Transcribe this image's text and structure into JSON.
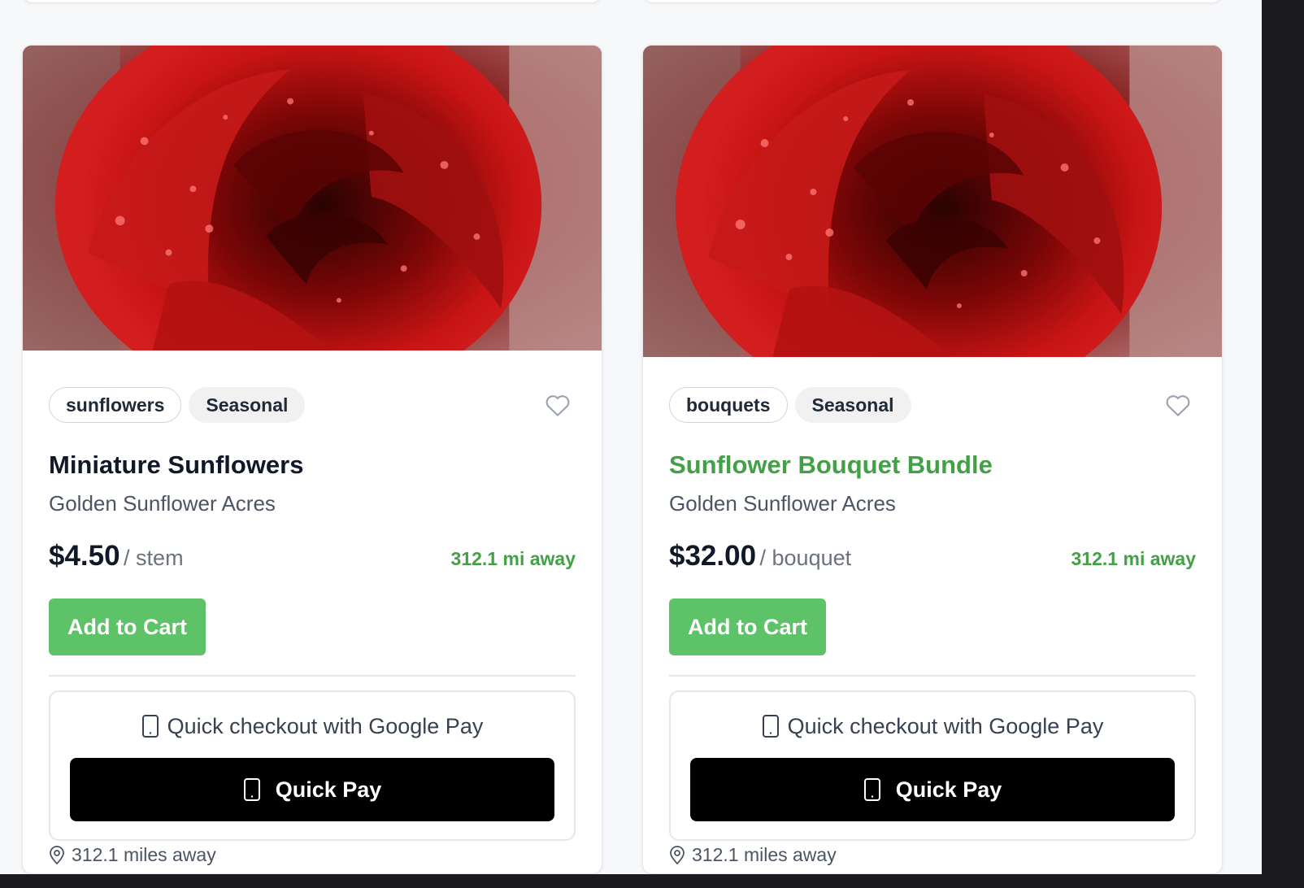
{
  "cards": [
    {
      "tags": [
        "sunflowers",
        "Seasonal"
      ],
      "title": "Miniature Sunflowers",
      "farm": "Golden Sunflower Acres",
      "price": "$4.50",
      "unit": "/ stem",
      "distance": "312.1 mi away",
      "add_to_cart": "Add to Cart",
      "quick_checkout": "Quick checkout with Google Pay",
      "quick_pay": "Quick Pay",
      "location": "312.1 miles away"
    },
    {
      "tags": [
        "bouquets",
        "Seasonal"
      ],
      "title": "Sunflower Bouquet Bundle",
      "farm": "Golden Sunflower Acres",
      "price": "$32.00",
      "unit": "/ bouquet",
      "distance": "312.1 mi away",
      "add_to_cart": "Add to Cart",
      "quick_checkout": "Quick checkout with Google Pay",
      "quick_pay": "Quick Pay",
      "location": "312.1 miles away"
    }
  ],
  "icons": {
    "favorite": "heart-icon",
    "phone": "smartphone-icon",
    "location": "map-pin-icon"
  },
  "colors": {
    "accent_green": "#5ec269",
    "distance_green": "#43a047",
    "title_hover_green": "#43a047",
    "quick_pay_bg": "#000000"
  }
}
